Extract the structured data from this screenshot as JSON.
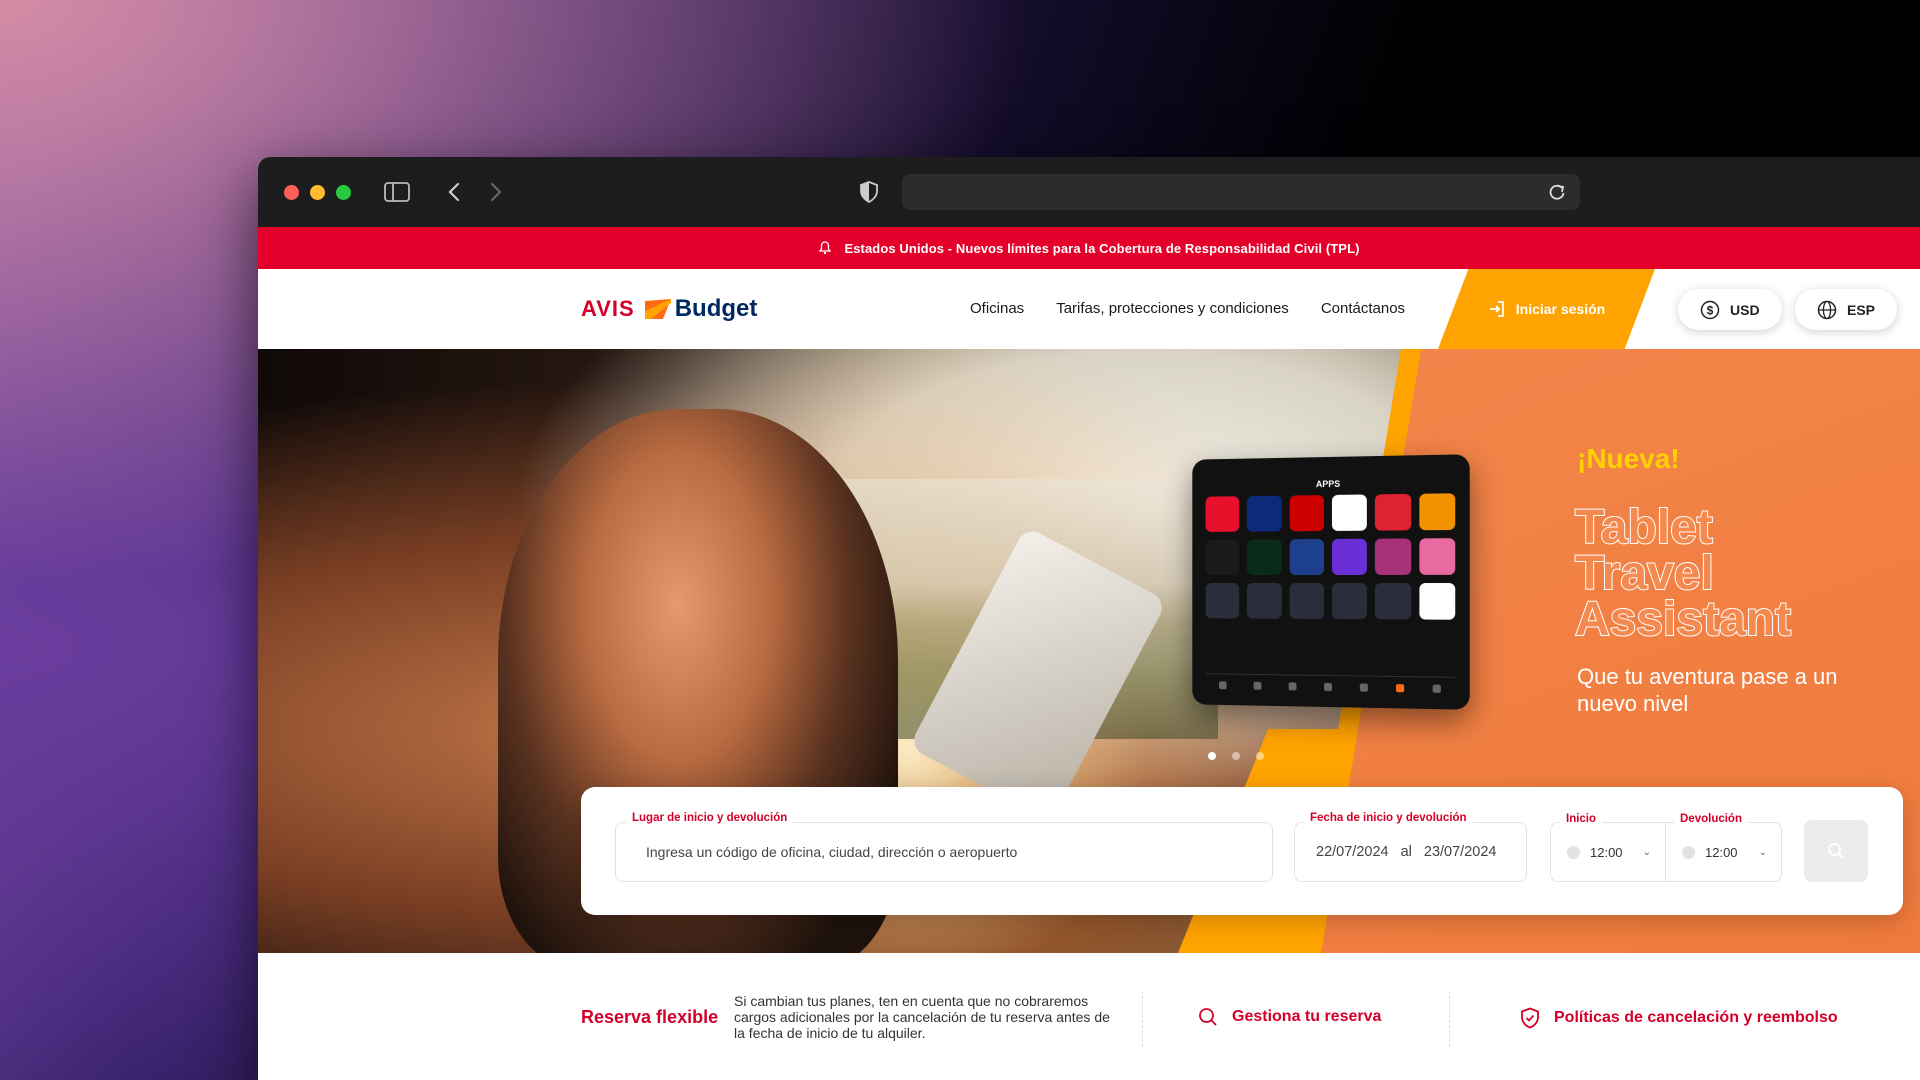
{
  "alert": {
    "text": "Estados Unidos - Nuevos límites para la Cobertura de Responsabilidad Civil (TPL)"
  },
  "brand": {
    "avis": "AVIS",
    "budget": "Budget"
  },
  "nav": {
    "offices": "Oficinas",
    "rates": "Tarifas, protecciones y condiciones",
    "contact": "Contáctanos"
  },
  "login": {
    "label": "Iniciar sesión"
  },
  "currency": {
    "label": "USD"
  },
  "language": {
    "label": "ESP"
  },
  "promo": {
    "kicker": "¡Nueva!",
    "title_lines": [
      "Tablet",
      "Travel",
      "Assistant"
    ],
    "subtitle": "Que tu aventura pase a un nuevo nivel",
    "tablet_header": "APPS"
  },
  "carousel": {
    "count": 3,
    "active": 0
  },
  "search": {
    "place_label": "Lugar de inicio y devolución",
    "place_placeholder": "Ingresa un código de oficina, ciudad, dirección o aeropuerto",
    "dates_label": "Fecha de inicio y devolución",
    "start_date": "22/07/2024",
    "date_sep": "al",
    "end_date": "23/07/2024",
    "start_time_label": "Inicio",
    "start_time": "12:00",
    "return_time_label": "Devolución",
    "return_time": "12:00"
  },
  "info": {
    "flex_title": "Reserva flexible",
    "flex_text": "Si cambian tus planes, ten en cuenta que no cobraremos cargos adicionales por la cancelación de tu reserva antes de la fecha de inicio de tu alquiler.",
    "manage": "Gestiona tu reserva",
    "policy": "Políticas de cancelación y reembolso"
  },
  "colors": {
    "brand_red": "#e4002b",
    "brand_orange": "#ffa300",
    "promo_orange": "#f58a50",
    "navy": "#00285f"
  }
}
